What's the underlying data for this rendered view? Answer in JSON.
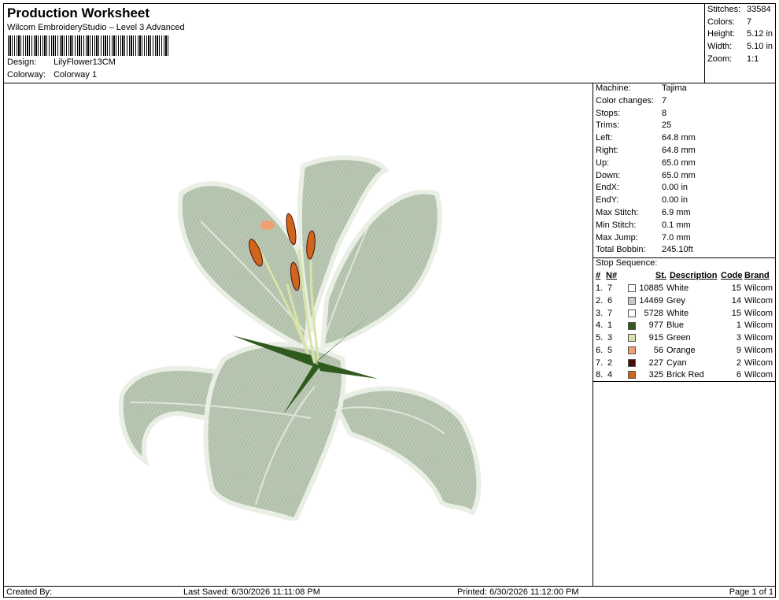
{
  "header": {
    "title": "Production Worksheet",
    "subtitle": "Wilcom EmbroideryStudio – Level 3 Advanced",
    "design_label": "Design:",
    "design_value": "LilyFlower13CM",
    "colorway_label": "Colorway:",
    "colorway_value": "Colorway 1"
  },
  "summary": {
    "stitches_label": "Stitches:",
    "stitches": "33584",
    "colors_label": "Colors:",
    "colors": "7",
    "height_label": "Height:",
    "height": "5.12 in",
    "width_label": "Width:",
    "width": "5.10 in",
    "zoom_label": "Zoom:",
    "zoom": "1:1"
  },
  "details": [
    {
      "k": "Machine:",
      "v": "Tajima"
    },
    {
      "k": "Color changes:",
      "v": "7"
    },
    {
      "k": "Stops:",
      "v": "8"
    },
    {
      "k": "Trims:",
      "v": "25"
    },
    {
      "k": "Left:",
      "v": "64.8 mm"
    },
    {
      "k": "Right:",
      "v": "64.8 mm"
    },
    {
      "k": "Up:",
      "v": "65.0 mm"
    },
    {
      "k": "Down:",
      "v": "65.0 mm"
    },
    {
      "k": "EndX:",
      "v": "0.00 in"
    },
    {
      "k": "EndY:",
      "v": "0.00 in"
    },
    {
      "k": "Max Stitch:",
      "v": "6.9 mm"
    },
    {
      "k": "Min Stitch:",
      "v": "0.1 mm"
    },
    {
      "k": "Max Jump:",
      "v": "7.0 mm"
    },
    {
      "k": "Total Bobbin:",
      "v": "245.10ft"
    }
  ],
  "stop_sequence_label": "Stop Sequence:",
  "stop_table": {
    "headers": [
      "#",
      "N#",
      "St.",
      "Description",
      "Code",
      "Brand"
    ],
    "rows": [
      {
        "num": "1.",
        "n": "7",
        "color": "#ffffff",
        "st": "10885",
        "desc": "White",
        "code": "15",
        "brand": "Wilcom"
      },
      {
        "num": "2.",
        "n": "6",
        "color": "#c8c8c8",
        "st": "14469",
        "desc": "Grey",
        "code": "14",
        "brand": "Wilcom"
      },
      {
        "num": "3.",
        "n": "7",
        "color": "#ffffff",
        "st": "5728",
        "desc": "White",
        "code": "15",
        "brand": "Wilcom"
      },
      {
        "num": "4.",
        "n": "1",
        "color": "#2f5a1e",
        "st": "977",
        "desc": "Blue",
        "code": "1",
        "brand": "Wilcom"
      },
      {
        "num": "5.",
        "n": "3",
        "color": "#d9e3a8",
        "st": "915",
        "desc": "Green",
        "code": "3",
        "brand": "Wilcom"
      },
      {
        "num": "6.",
        "n": "5",
        "color": "#f0a070",
        "st": "56",
        "desc": "Orange",
        "code": "9",
        "brand": "Wilcom"
      },
      {
        "num": "7.",
        "n": "2",
        "color": "#4a0e06",
        "st": "227",
        "desc": "Cyan",
        "code": "2",
        "brand": "Wilcom"
      },
      {
        "num": "8.",
        "n": "4",
        "color": "#d0651e",
        "st": "325",
        "desc": "Brick Red",
        "code": "6",
        "brand": "Wilcom"
      }
    ]
  },
  "footer": {
    "created_by": "Created By:",
    "last_saved": "Last Saved: 6/30/2026 11:11:08 PM",
    "printed": "Printed: 6/30/2026 11:12:00 PM",
    "page": "Page 1 of 1"
  }
}
